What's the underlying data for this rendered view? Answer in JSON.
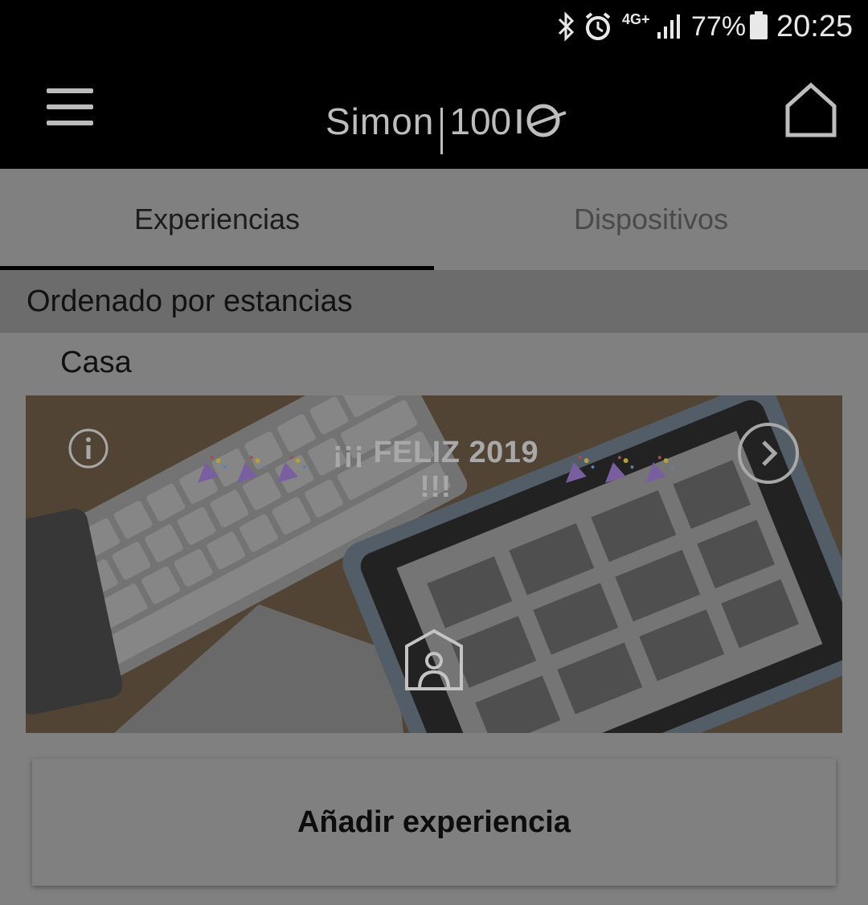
{
  "status_bar": {
    "network": "4G+",
    "battery": "77%",
    "time": "20:25",
    "icons": [
      "bluetooth-icon",
      "alarm-icon",
      "signal-icon",
      "battery-icon"
    ]
  },
  "app_bar": {
    "logo_simon": "Simon",
    "logo_model": "100",
    "logo_suffix": "iO"
  },
  "tabs": [
    {
      "label": "Experiencias",
      "selected": true
    },
    {
      "label": "Dispositivos",
      "selected": false
    }
  ],
  "section_header": "Ordenado por estancias",
  "room": "Casa",
  "experience_card": {
    "title": "¡¡¡ FELIZ 2019 !!!"
  },
  "add_button": "Añadir experiencia",
  "colors": {
    "app_bar": "#000000",
    "dim_background": "#808080",
    "tab_indicator": "#000000"
  }
}
